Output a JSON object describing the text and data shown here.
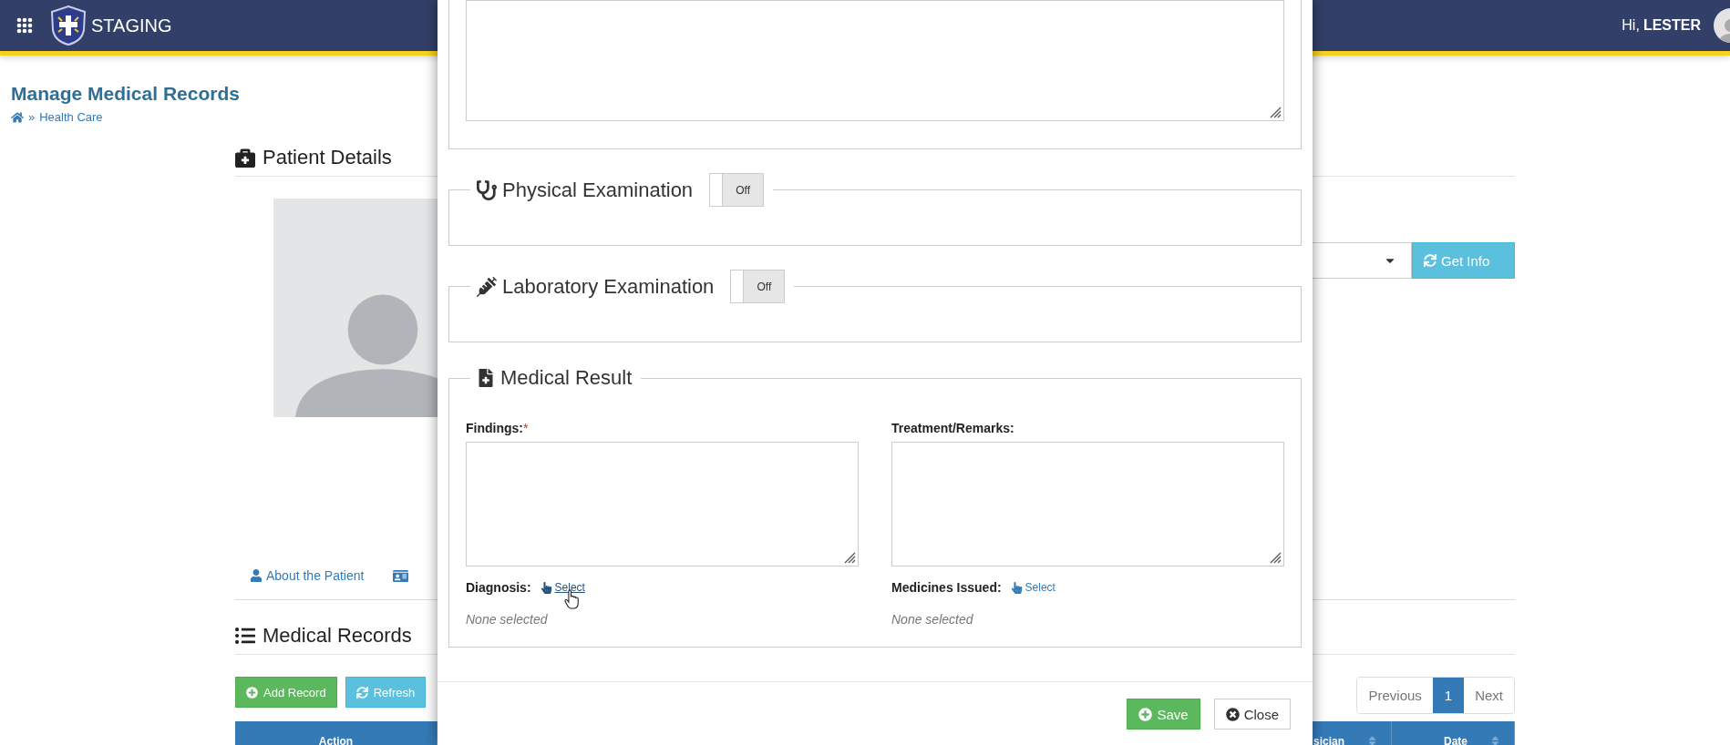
{
  "header": {
    "brand": "STAGING",
    "greeting": "Hi,",
    "user": "LESTER"
  },
  "page": {
    "title": "Manage Medical Records",
    "breadcrumb_separator": "»",
    "breadcrumb": [
      "Health Care"
    ]
  },
  "patient_details": {
    "title": "Patient Details",
    "get_info_button": "Get Info"
  },
  "patient_tabs": [
    {
      "label": "About the Patient",
      "selected": false
    }
  ],
  "medical_records": {
    "title": "Medical Records",
    "buttons": [
      {
        "label": "Add Record",
        "kind": "add"
      },
      {
        "label": "Refresh",
        "kind": "refresh"
      }
    ],
    "pagination": {
      "previous": "Previous",
      "pages": [
        {
          "label": "1",
          "selected": true
        }
      ],
      "next": "Next"
    },
    "columns": [
      {
        "label": "Action",
        "kind": "action"
      },
      {
        "label": "sician",
        "kind": "sortable"
      },
      {
        "label": "Date",
        "kind": "sortable"
      }
    ]
  },
  "modal": {
    "sections": [
      {
        "title": "Physical Examination",
        "kind": "stethoscope",
        "on": false,
        "toggle_label": "Off"
      },
      {
        "title": "Laboratory Examination",
        "kind": "syringe",
        "on": false,
        "toggle_label": "Off"
      }
    ],
    "medical_result": {
      "title": "Medical Result",
      "fields": [
        {
          "label": "Findings:",
          "required_mark": "*"
        },
        {
          "label": "Treatment/Remarks:"
        }
      ],
      "pickers": [
        {
          "label": "Diagnosis:",
          "link": "Select",
          "value": "None selected",
          "hovered": true
        },
        {
          "label": "Medicines Issued:",
          "link": "Select",
          "value": "None selected",
          "hovered": false
        }
      ]
    },
    "buttons": [
      {
        "label": "Save",
        "kind": "save"
      },
      {
        "label": "Close",
        "kind": "close"
      }
    ]
  }
}
